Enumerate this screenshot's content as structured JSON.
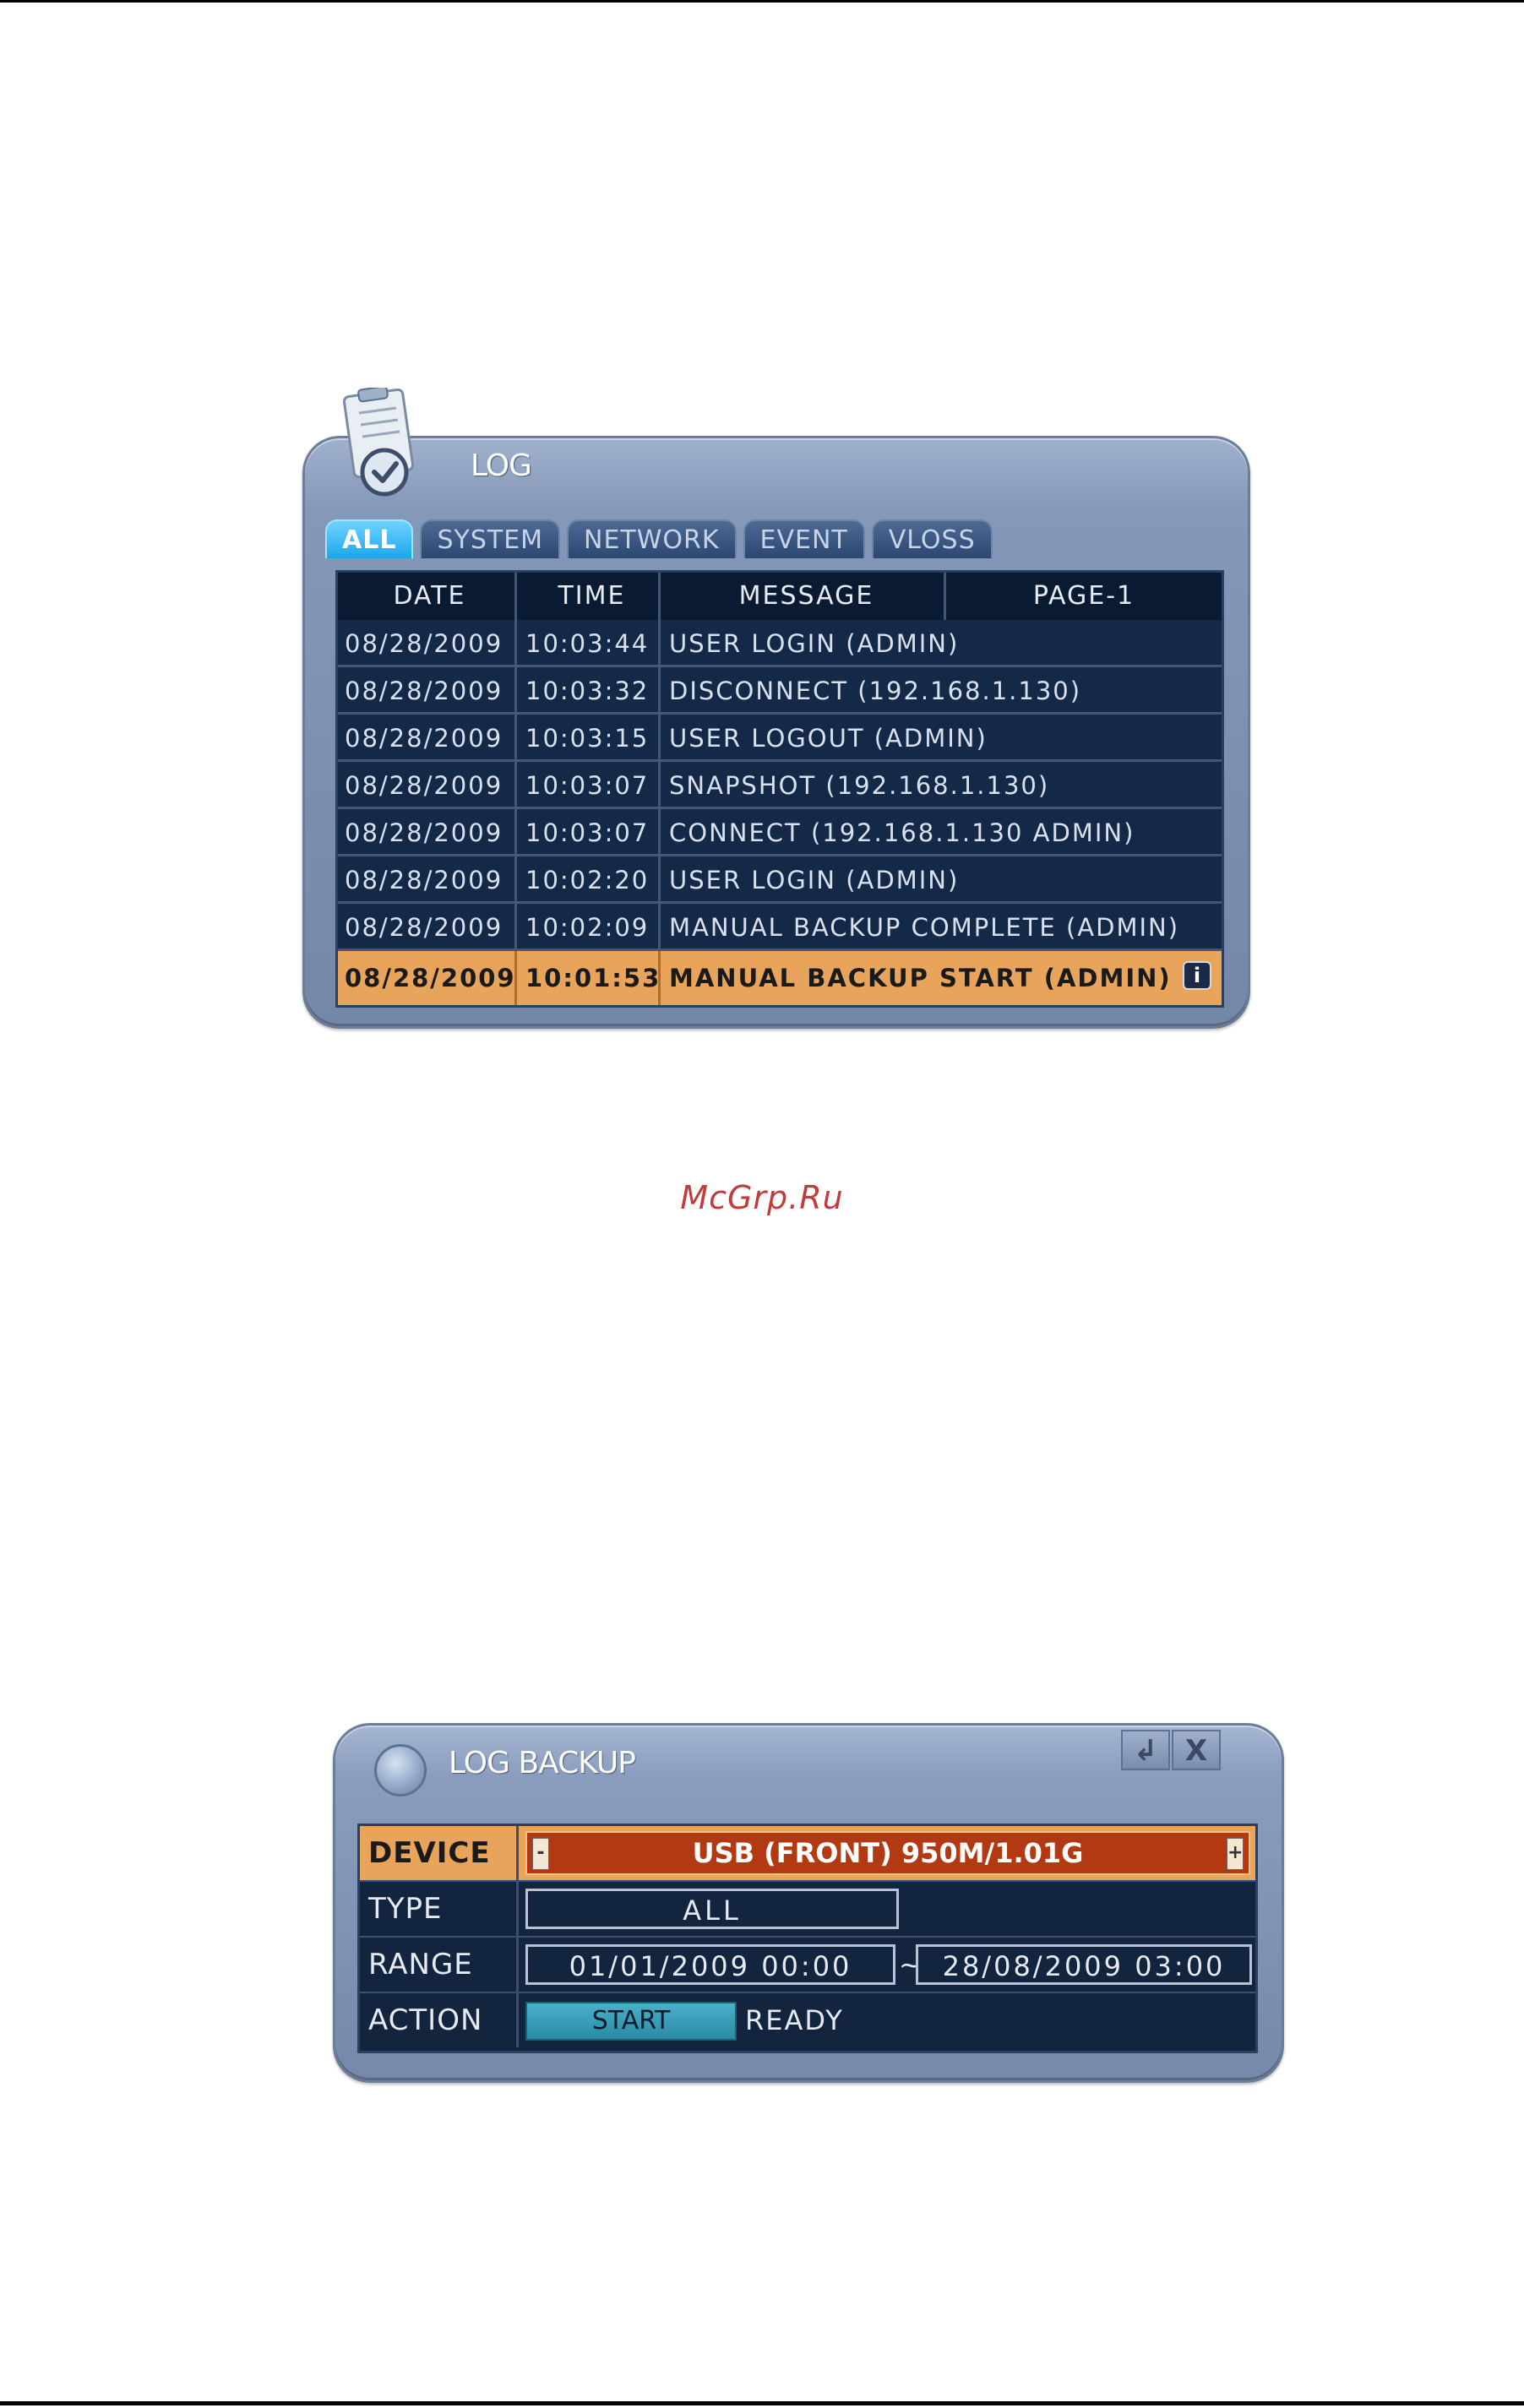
{
  "log": {
    "title": "LOG",
    "tabs": [
      "ALL",
      "SYSTEM",
      "NETWORK",
      "EVENT",
      "VLOSS"
    ],
    "active_tab": "ALL",
    "columns": {
      "date": "DATE",
      "time": "TIME",
      "message": "MESSAGE",
      "page": "PAGE-1"
    },
    "rows": [
      {
        "date": "08/28/2009",
        "time": "10:03:44",
        "message": "USER LOGIN (ADMIN)"
      },
      {
        "date": "08/28/2009",
        "time": "10:03:32",
        "message": "DISCONNECT (192.168.1.130)"
      },
      {
        "date": "08/28/2009",
        "time": "10:03:15",
        "message": "USER LOGOUT (ADMIN)"
      },
      {
        "date": "08/28/2009",
        "time": "10:03:07",
        "message": "SNAPSHOT (192.168.1.130)"
      },
      {
        "date": "08/28/2009",
        "time": "10:03:07",
        "message": "CONNECT (192.168.1.130 ADMIN)"
      },
      {
        "date": "08/28/2009",
        "time": "10:02:20",
        "message": "USER LOGIN (ADMIN)"
      },
      {
        "date": "08/28/2009",
        "time": "10:02:09",
        "message": "MANUAL BACKUP COMPLETE (ADMIN)"
      },
      {
        "date": "08/28/2009",
        "time": "10:01:53",
        "message": "MANUAL BACKUP START (ADMIN)"
      }
    ],
    "selected_row": 7,
    "info_glyph": "i"
  },
  "watermark": "McGrp.Ru",
  "backup": {
    "title": "LOG BACKUP",
    "enter_glyph": "↲",
    "close_glyph": "X",
    "labels": {
      "device": "DEVICE",
      "type": "TYPE",
      "range": "RANGE",
      "action": "ACTION"
    },
    "device_value": "USB (FRONT) 950M/1.01G",
    "device_minus": "-",
    "device_plus": "+",
    "type_value": "ALL",
    "range_from": "01/01/2009  00:00",
    "range_sep": "~",
    "range_to": "28/08/2009  03:00",
    "start_label": "START",
    "status": "READY"
  },
  "colors": {
    "accent_selected": "#e8a45a",
    "active_tab": "#1ca7e8",
    "device_field": "#b33912",
    "watermark": "#c23c3c"
  }
}
